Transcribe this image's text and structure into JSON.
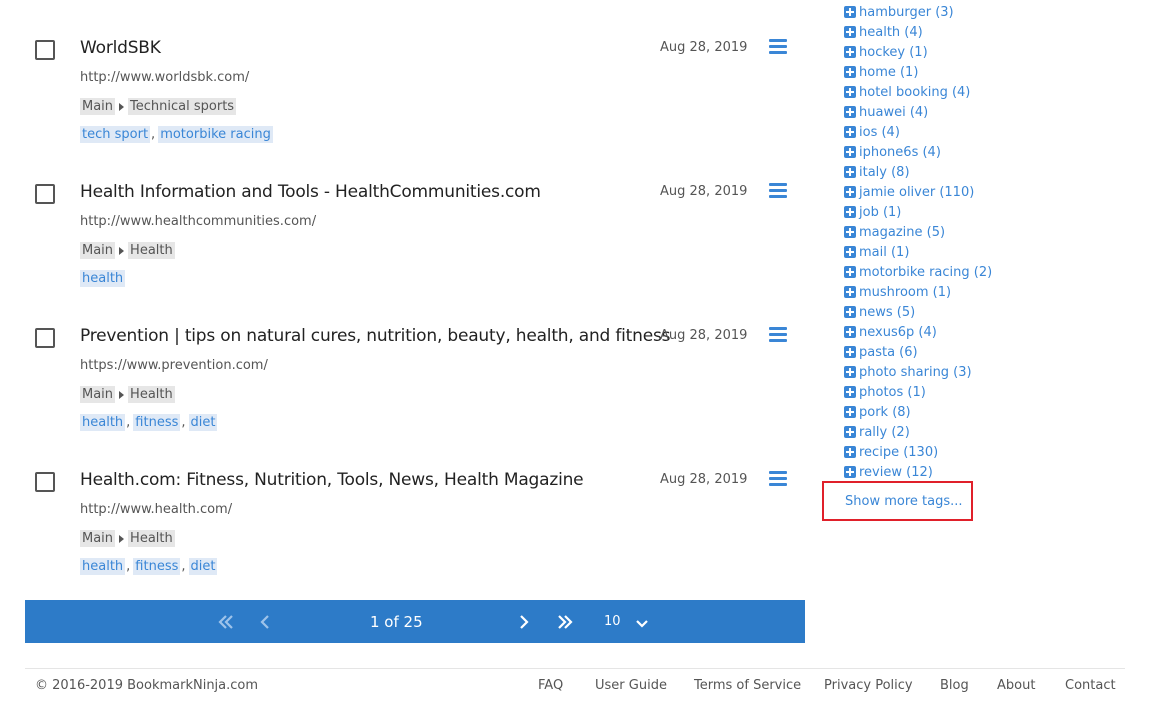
{
  "bookmarks": [
    {
      "title": "WorldSBK",
      "url": "http://www.worldsbk.com/",
      "path": [
        "Main",
        "Technical sports"
      ],
      "tags": [
        "tech sport",
        "motorbike racing"
      ],
      "date": "Aug 28, 2019"
    },
    {
      "title": "Health Information and Tools - HealthCommunities.com",
      "url": "http://www.healthcommunities.com/",
      "path": [
        "Main",
        "Health"
      ],
      "tags": [
        "health"
      ],
      "date": "Aug 28, 2019"
    },
    {
      "title": "Prevention | tips on natural cures, nutrition, beauty, health, and fitness",
      "url": "https://www.prevention.com/",
      "path": [
        "Main",
        "Health"
      ],
      "tags": [
        "health",
        "fitness",
        "diet"
      ],
      "date": "Aug 28, 2019"
    },
    {
      "title": "Health.com: Fitness, Nutrition, Tools, News, Health Magazine",
      "url": "http://www.health.com/",
      "path": [
        "Main",
        "Health"
      ],
      "tags": [
        "health",
        "fitness",
        "diet"
      ],
      "date": "Aug 28, 2019"
    }
  ],
  "sidebar_tags": [
    "hamburger (3)",
    "health (4)",
    "hockey (1)",
    "home (1)",
    "hotel booking (4)",
    "huawei (4)",
    "ios (4)",
    "iphone6s (4)",
    "italy (8)",
    "jamie oliver (110)",
    "job (1)",
    "magazine (5)",
    "mail (1)",
    "motorbike racing (2)",
    "mushroom (1)",
    "news (5)",
    "nexus6p (4)",
    "pasta (6)",
    "photo sharing (3)",
    "photos (1)",
    "pork (8)",
    "rally (2)",
    "recipe (130)",
    "review (12)"
  ],
  "show_more_label": "Show more tags...",
  "pagination": {
    "text": "1 of 25",
    "per_page": "10"
  },
  "footer": {
    "copyright": "© 2016-2019 BookmarkNinja.com",
    "links": [
      "FAQ",
      "User Guide",
      "Terms of Service",
      "Privacy Policy",
      "Blog",
      "About",
      "Contact"
    ]
  },
  "colors": {
    "accent": "#2d7bc8",
    "link": "#3a86d6",
    "highlight_border": "#e0202a"
  }
}
